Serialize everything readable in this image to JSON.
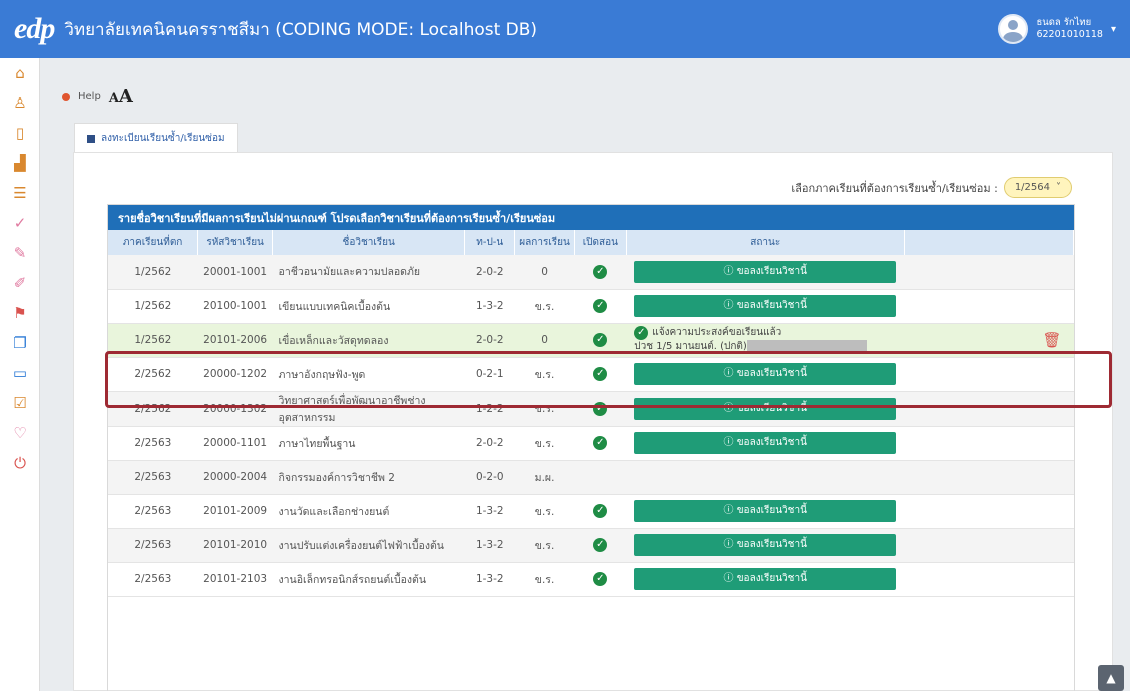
{
  "header": {
    "logo_text": "edp",
    "title": "วิทยาลัยเทคนิคนครราชสีมา (CODING MODE: Localhost DB)",
    "user_name": "ธนดล รักไทย",
    "user_id": "62201010118",
    "user_caret": "▾"
  },
  "sidebar": {
    "icons": [
      "home-icon",
      "user-icon",
      "book-icon",
      "chart-icon",
      "list-icon",
      "check-icon",
      "pencil-icon",
      "edit-icon",
      "flag-icon",
      "copy-icon",
      "card-icon",
      "checkbox-icon",
      "heart-icon",
      "power-icon"
    ]
  },
  "toolbar": {
    "help_label": "Help",
    "font_size_large": "A",
    "font_size_small": "A"
  },
  "tab": {
    "label": "ลงทะเบียนเรียนซ้ำ/เรียนซ่อม"
  },
  "term_select": {
    "label": "เลือกภาคเรียนที่ต้องการเรียนซ้ำ/เรียนซ่อม :",
    "value": "1/2564",
    "caret": "˅"
  },
  "table": {
    "title": "รายชื่อวิชาเรียนที่มีผลการเรียนไม่ผ่านเกณฑ์ โปรดเลือกวิชาเรียนที่ต้องการเรียนซ้ำ/เรียนซ่อม",
    "columns": [
      "ภาคเรียนที่ตก",
      "รหัสวิชาเรียน",
      "ชื่อวิชาเรียน",
      "ท-ป-น",
      "ผลการเรียน",
      "เปิดสอน",
      "สถานะ",
      ""
    ],
    "action_label": "ⓘ ขอลงเรียนวิชานี้",
    "check_glyph": "✓",
    "trash_glyph": "🗑",
    "rows": [
      {
        "term": "1/2562",
        "code": "20001-1001",
        "name": "อาชีวอนามัยและความปลอดภัย",
        "tpn": "2-0-2",
        "grade": "0",
        "open": true,
        "status": "button"
      },
      {
        "term": "1/2562",
        "code": "20100-1001",
        "name": "เขียนแบบเทคนิคเบื้องต้น",
        "tpn": "1-3-2",
        "grade": "ข.ร.",
        "open": true,
        "status": "button"
      },
      {
        "term": "1/2562",
        "code": "20101-2006",
        "name": "เขื่อเหล็กและวัสดุทดลอง",
        "tpn": "2-0-2",
        "grade": "0",
        "open": true,
        "status": "requested",
        "status_line1": "แจ้งความประสงค์ขอเรียนแล้ว",
        "status_line2": "ปวช 1/5 มานยนต์. (ปกติ)"
      },
      {
        "term": "2/2562",
        "code": "20000-1202",
        "name": "ภาษาอังกฤษฟัง-พูด",
        "tpn": "0-2-1",
        "grade": "ข.ร.",
        "open": true,
        "status": "button"
      },
      {
        "term": "2/2562",
        "code": "20000-1302",
        "name": "วิทยาศาสตร์เพื่อพัฒนาอาชีพช่างอุตสาหกรรม",
        "tpn": "1-2-2",
        "grade": "ข.ร.",
        "open": true,
        "status": "button"
      },
      {
        "term": "2/2563",
        "code": "20000-1101",
        "name": "ภาษาไทยพื้นฐาน",
        "tpn": "2-0-2",
        "grade": "ข.ร.",
        "open": true,
        "status": "button"
      },
      {
        "term": "2/2563",
        "code": "20000-2004",
        "name": "กิจกรรมองค์การวิชาชีพ 2",
        "tpn": "0-2-0",
        "grade": "ม.ผ.",
        "open": false,
        "status": "none"
      },
      {
        "term": "2/2563",
        "code": "20101-2009",
        "name": "งานวัดและเลือกช่างยนต์",
        "tpn": "1-3-2",
        "grade": "ข.ร.",
        "open": true,
        "status": "button"
      },
      {
        "term": "2/2563",
        "code": "20101-2010",
        "name": "งานปรับแต่งเครื่องยนต์ไฟฟ้าเบื้องต้น",
        "tpn": "1-3-2",
        "grade": "ข.ร.",
        "open": true,
        "status": "button"
      },
      {
        "term": "2/2563",
        "code": "20101-2103",
        "name": "งานอิเล็กทรอนิกส์รถยนต์เบื้องต้น",
        "tpn": "1-3-2",
        "grade": "ข.ร.",
        "open": true,
        "status": "button"
      }
    ]
  },
  "scroll_top_glyph": "▲"
}
